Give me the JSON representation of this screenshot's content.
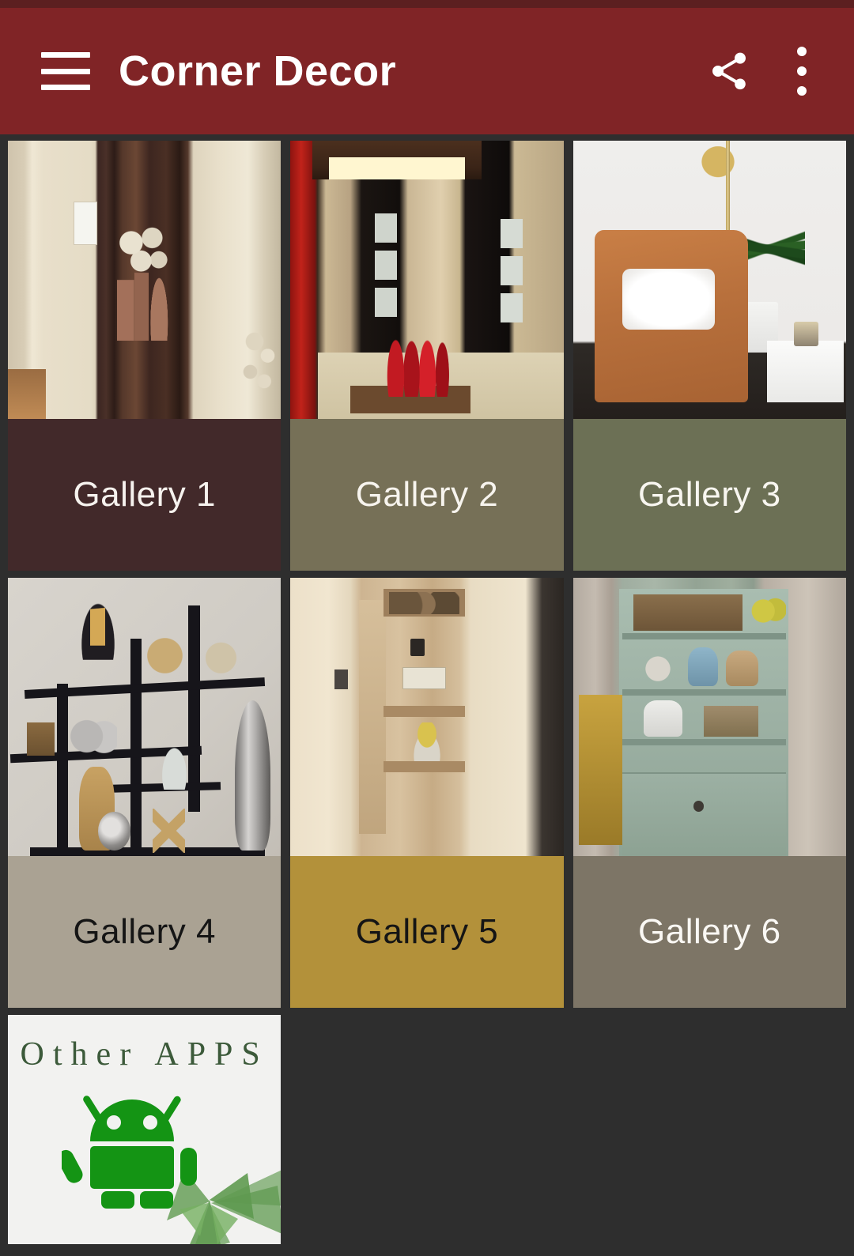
{
  "app": {
    "title": "Corner Decor",
    "statusbar_color": "#5c1f20",
    "appbar_color": "#802426",
    "page_background": "#2e2e2e"
  },
  "appbar": {
    "menu_icon": "hamburger-menu-icon",
    "share_icon": "share-icon",
    "overflow_icon": "more-vert-icon"
  },
  "galleries": [
    {
      "label": "Gallery 1",
      "label_bg": "#42292a",
      "label_fg": "#f6f2ee",
      "image_alt": "Dark carved wood corner shelf unit with copper vases and white blossom branches in a beige hallway"
    },
    {
      "label": "Gallery 2",
      "label_bg": "#767057",
      "label_fg": "#f7f4ee",
      "image_alt": "Stone-clad entryway corner with recessed ceiling lights, dark doors and four red glossy vases on a wooden plinth"
    },
    {
      "label": "Gallery 3",
      "label_bg": "#6c7055",
      "label_fg": "#f8f6f0",
      "image_alt": "Tan leather armchair with white fur pillow, snake plant in white pot, gold arc lamp and white marble side table"
    },
    {
      "label": "Gallery 4",
      "label_bg": "#aaa293",
      "label_fg": "#151515",
      "image_alt": "Black modern wall shelf grid holding vases, silver spheres, rattan balls and a tall metallic vase"
    },
    {
      "label": "Gallery 5",
      "label_bg": "#b3913a",
      "label_fg": "#151515",
      "image_alt": "Rustic wood corner shelves on a cream wall with small trinkets, a sign plaque and a glass bowl of yellow flowers"
    },
    {
      "label": "Gallery 6",
      "label_bg": "#7d7566",
      "label_fg": "#faf8f4",
      "image_alt": "Distressed sage green corner cabinet with books, pitchers, pottery and a gilded ornament beside a stone wall"
    }
  ],
  "other_apps": {
    "title": "Other APPS",
    "title_color": "#3c5a3a",
    "android_icon": "android-robot-icon",
    "android_color": "#149414",
    "background": "#f2f2f0",
    "decoration": "succulent-plant-photo"
  }
}
